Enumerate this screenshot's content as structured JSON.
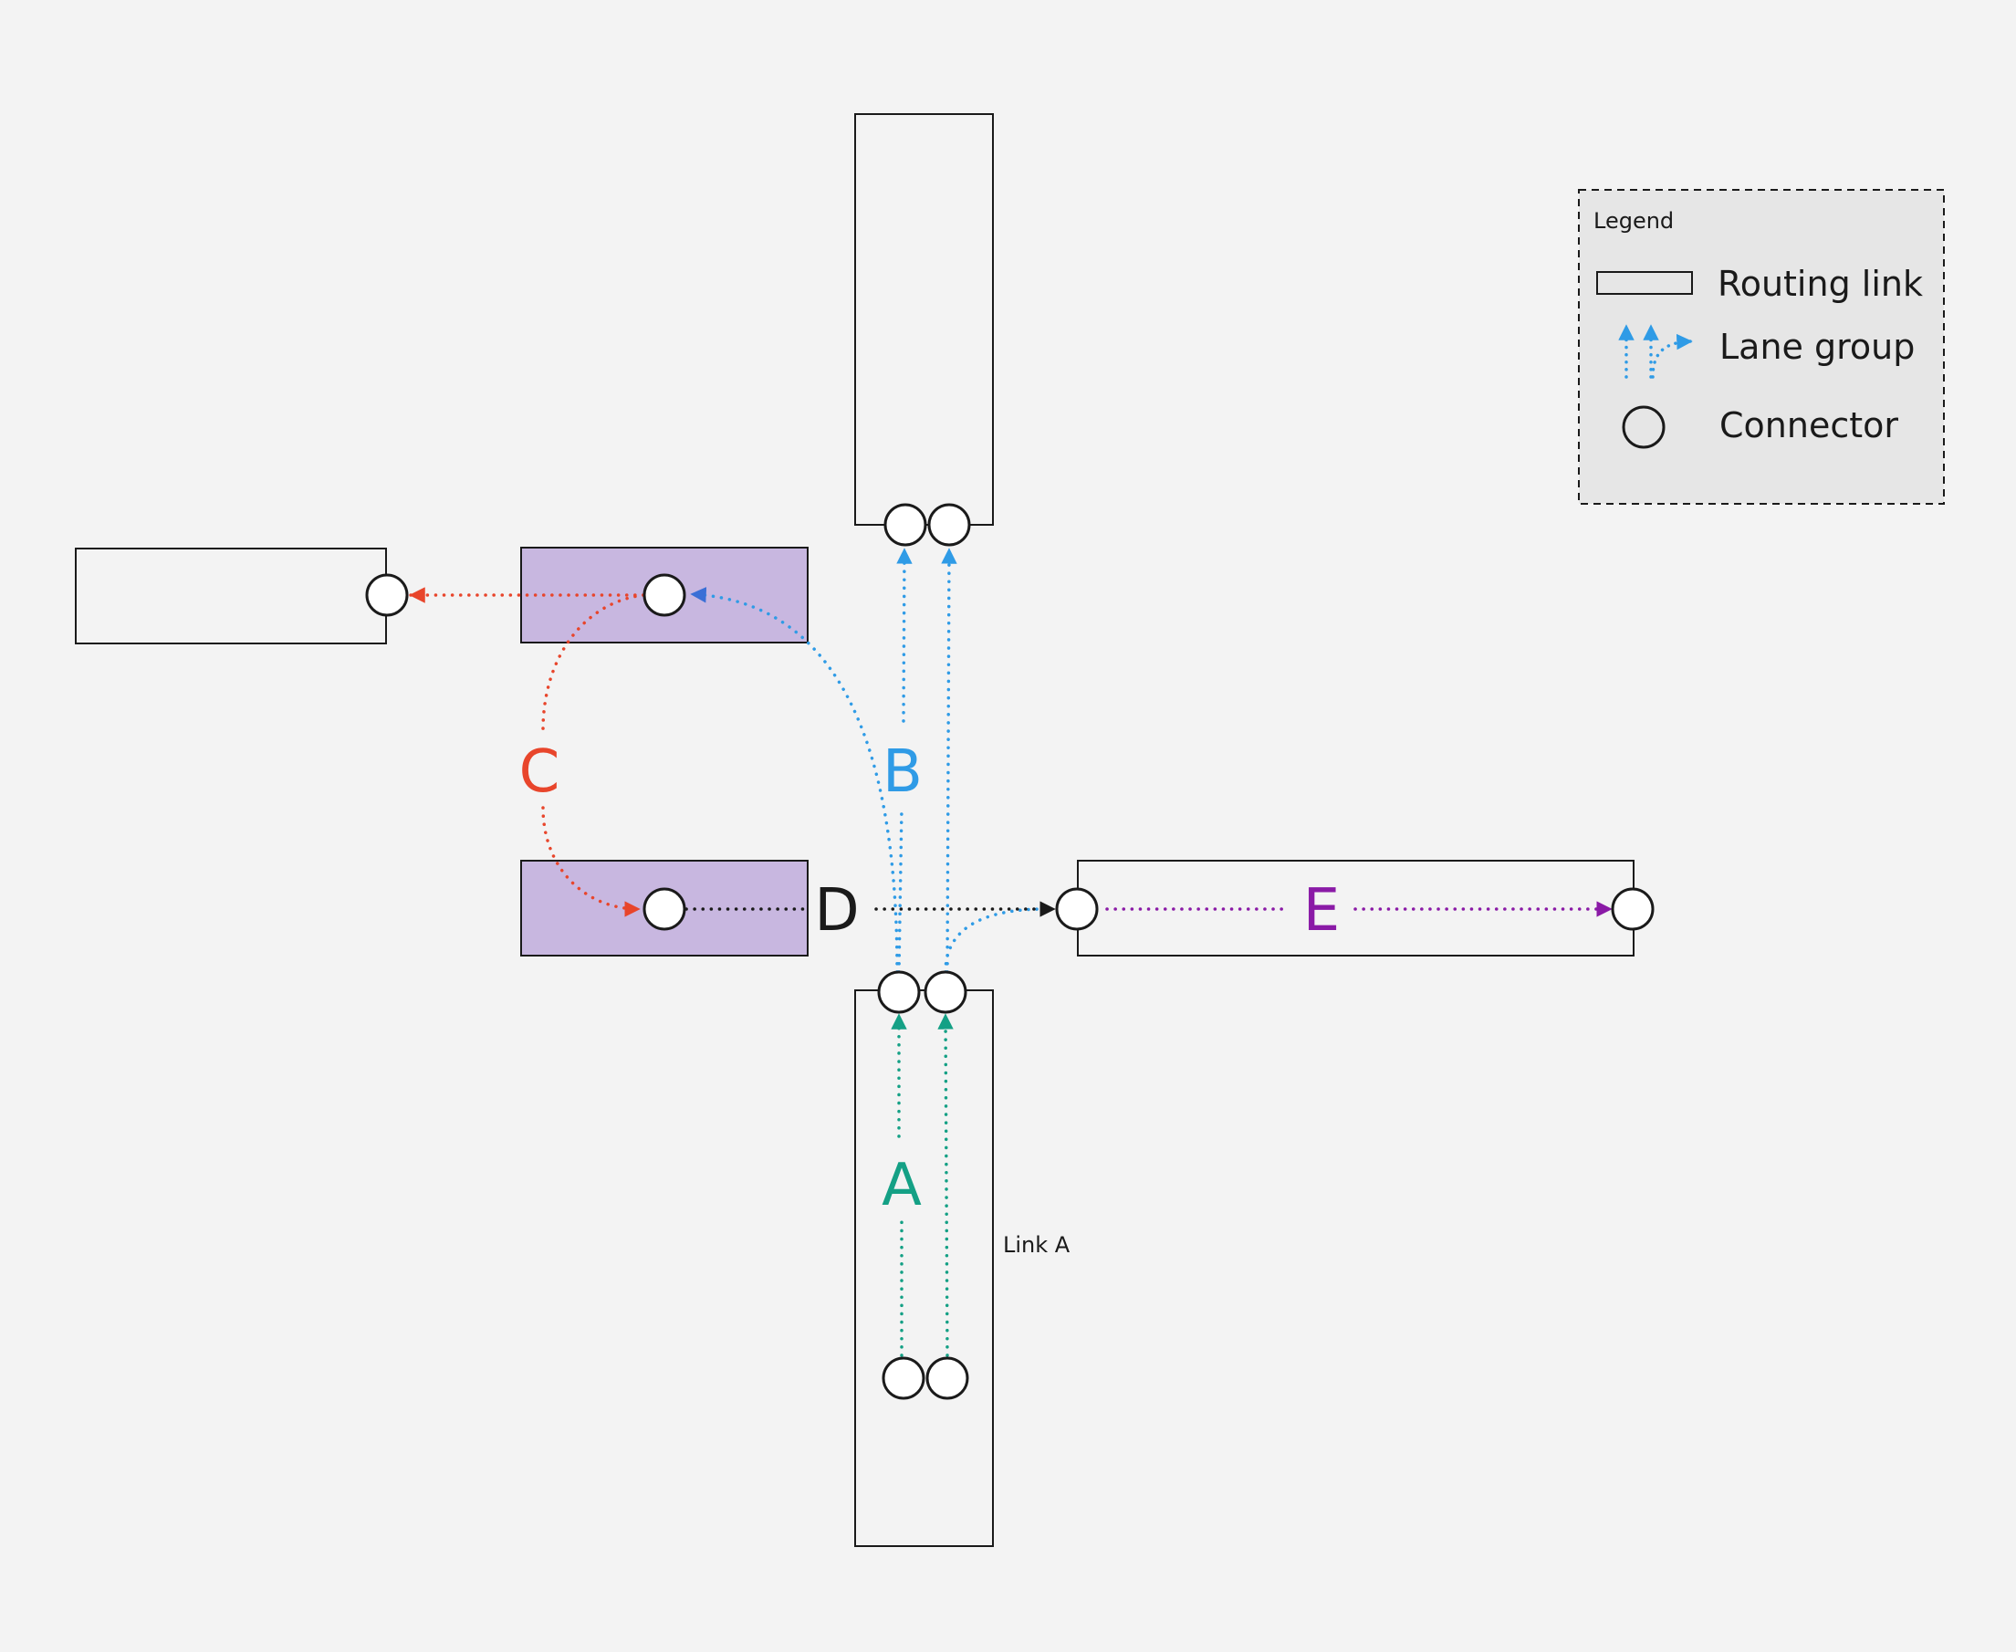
{
  "legend": {
    "title": "Legend",
    "routing_link": "Routing link",
    "lane_group": "Lane group",
    "connector": "Connector"
  },
  "links": {
    "south_label": "Link A"
  },
  "lane_groups": {
    "a": "A",
    "b": "B",
    "c": "C",
    "d": "D",
    "e": "E"
  },
  "colors": {
    "background": "#f3f3f3",
    "highlight_fill": "#c8b7e0",
    "lane_a": "#14a085",
    "lane_b": "#2f9be6",
    "lane_b_arrowhead": "#3a6fd6",
    "lane_c": "#e8452b",
    "lane_d": "#1a1a1a",
    "lane_e": "#8a1aa6",
    "legend_fill": "#e6e6e6"
  }
}
